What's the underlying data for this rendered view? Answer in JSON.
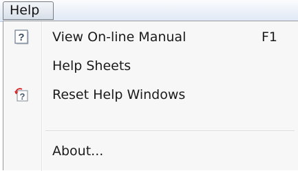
{
  "menubar": {
    "title": "Help"
  },
  "menu": {
    "items": [
      {
        "label": "View On-line Manual",
        "shortcut": "F1",
        "icon": "help-manual-icon"
      },
      {
        "label": "Help Sheets"
      },
      {
        "label": "Reset Help Windows",
        "icon": "reset-help-icon"
      },
      {
        "label": "About..."
      }
    ]
  }
}
